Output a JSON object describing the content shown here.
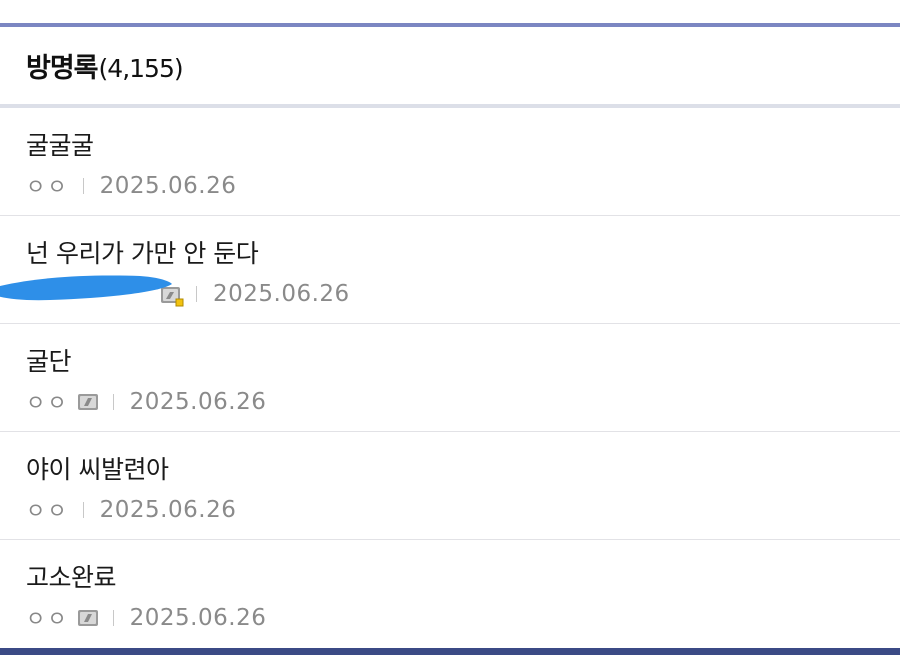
{
  "guestbook": {
    "title": "방명록",
    "count": "(4,155)"
  },
  "entries": [
    {
      "title": "굴굴굴",
      "author": "ㅇㅇ",
      "date": "2025.06.26",
      "badge": ""
    },
    {
      "title": "넌 우리가 가만 안 둔다",
      "author": "",
      "date": "2025.06.26",
      "badge": "fixed-nick-icon"
    },
    {
      "title": "굴단",
      "author": "ㅇㅇ",
      "date": "2025.06.26",
      "badge": "semi-fixed-nick-icon"
    },
    {
      "title": "야이 씨발련아",
      "author": "ㅇㅇ",
      "date": "2025.06.26",
      "badge": ""
    },
    {
      "title": "고소완료",
      "author": "ㅇㅇ",
      "date": "2025.06.26",
      "badge": "semi-fixed-nick-icon"
    }
  ],
  "colors": {
    "top_border": "#7b86c2",
    "bottom_border": "#3b4a85",
    "redaction": "#2e8fe8"
  }
}
